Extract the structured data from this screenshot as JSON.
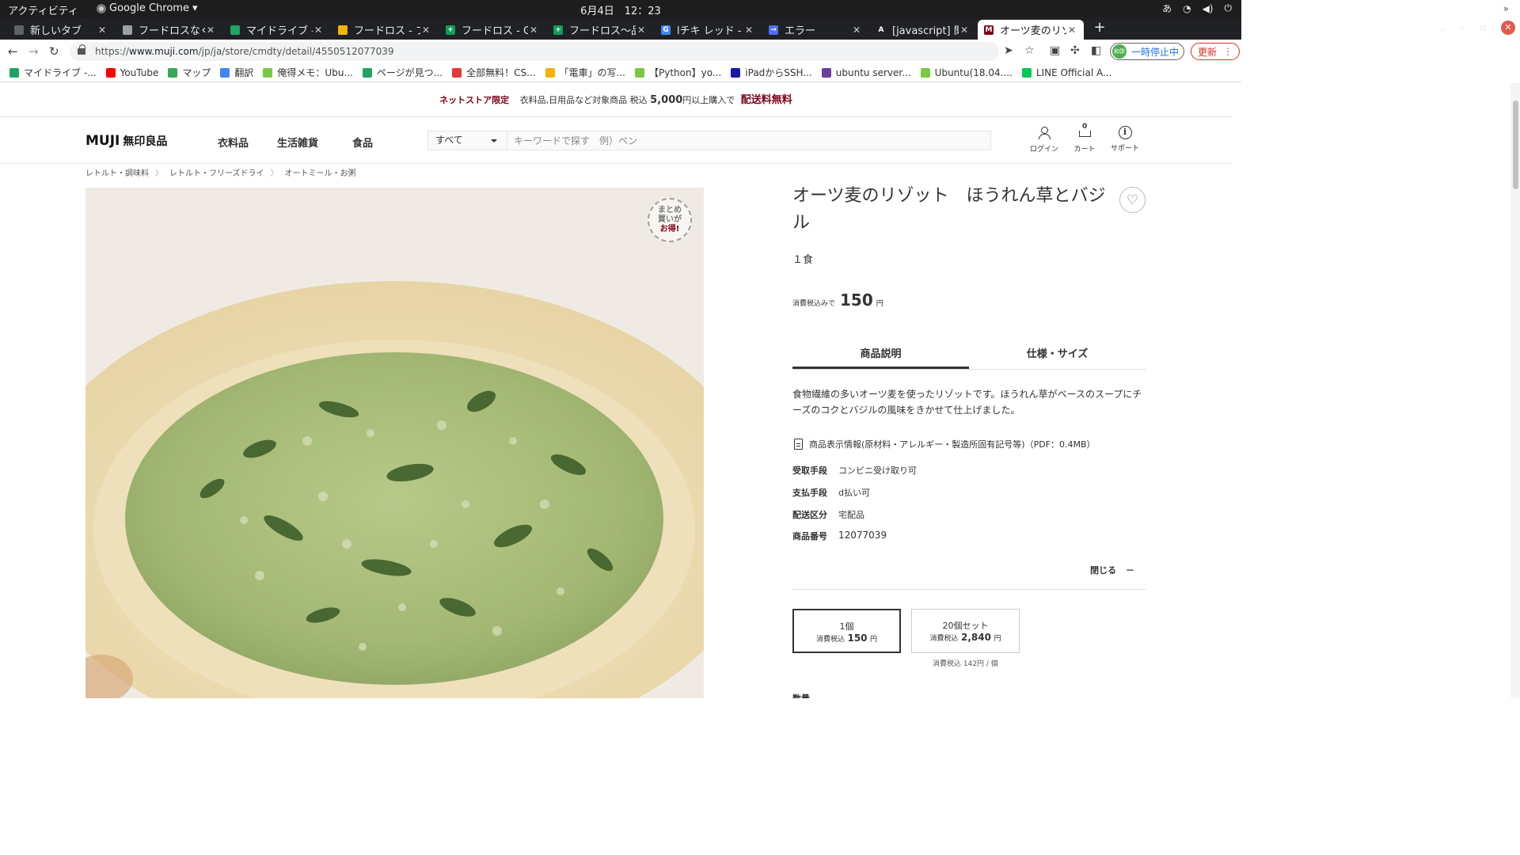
{
  "system": {
    "activities": "アクティビティ",
    "app_name": "Google Chrome",
    "clock": "6月4日　12：23",
    "ime": "あ"
  },
  "tabs": [
    {
      "title": "新しいタブ",
      "fav_color": "#5f6368",
      "fav_text": ""
    },
    {
      "title": "フードロスなく",
      "fav_color": "#9aa0a6",
      "fav_text": ""
    },
    {
      "title": "マイドライブ - G",
      "fav_color": "#1fa463",
      "fav_text": ""
    },
    {
      "title": "フードロス - ブ",
      "fav_color": "#f4b400",
      "fav_text": ""
    },
    {
      "title": "フードロス - Go",
      "fav_color": "#0f9d58",
      "fav_text": "+"
    },
    {
      "title": "フードロス〜品",
      "fav_color": "#0f9d58",
      "fav_text": "+"
    },
    {
      "title": "lチキ レッド - G",
      "fav_color": "#4285f4",
      "fav_text": "G"
    },
    {
      "title": "エラー",
      "fav_color": "#4b6ef5",
      "fav_text": "→"
    },
    {
      "title": "[javascript] 関連",
      "fav_color": "#222222",
      "fav_text": "A"
    },
    {
      "title": "オーツ麦のリゾ",
      "fav_color": "#7f0019",
      "fav_text": "M"
    }
  ],
  "address": {
    "scheme": "https://",
    "host": "www.muji.com",
    "path": "/jp/ja/store/cmdty/detail/4550512077039"
  },
  "profile": {
    "pause_label": "一時停止中",
    "avatar_label": "和弥",
    "update_label": "更新"
  },
  "bookmarks": [
    {
      "label": "マイドライブ -...",
      "color": "#1fa463"
    },
    {
      "label": "YouTube",
      "color": "#ff0000"
    },
    {
      "label": "マップ",
      "color": "#34a853"
    },
    {
      "label": "翻訳",
      "color": "#4285f4"
    },
    {
      "label": "俺得メモ：Ubu...",
      "color": "#7ac943"
    },
    {
      "label": "ページが見つ...",
      "color": "#1fa463"
    },
    {
      "label": "全部無料！CS...",
      "color": "#e53935"
    },
    {
      "label": "「電車」の写...",
      "color": "#f4b400"
    },
    {
      "label": "【Python】yo...",
      "color": "#7ac943"
    },
    {
      "label": "iPadからSSH...",
      "color": "#1a1aa6"
    },
    {
      "label": "ubuntu server...",
      "color": "#6b3fa0"
    },
    {
      "label": "Ubuntu(18.04....",
      "color": "#7ac943"
    },
    {
      "label": "LINE Official A...",
      "color": "#06c755"
    }
  ],
  "promo": {
    "tag": "ネットストア限定",
    "text_before": "衣料品,日用品など対象商品 税込",
    "amount": "5,000",
    "text_after": "円以上購入で",
    "highlight": "配送料無料"
  },
  "header": {
    "logo_main": "MUJI",
    "logo_sub": "無印良品",
    "nav": [
      "衣料品",
      "生活雑貨",
      "食品"
    ],
    "search_category": "すべて",
    "search_placeholder": "キーワードで探す　例）ペン",
    "login_label": "ログイン",
    "cart_label": "カート",
    "cart_count": "0",
    "support_label": "サポート"
  },
  "breadcrumb": [
    "レトルト・調味料",
    "レトルト・フリーズドライ",
    "オートミール・お粥"
  ],
  "badge": {
    "line1": "まとめ",
    "line2": "買いが",
    "line3": "お得!"
  },
  "product": {
    "title": "オーツ麦のリゾット　ほうれん草とバジル",
    "unit": "１食",
    "price_label": "消費税込みで",
    "price": "150",
    "price_unit": "円",
    "tabs": [
      "商品説明",
      "仕様・サイズ"
    ],
    "description": "食物繊維の多いオーツ麦を使ったリゾットです。ほうれん草がベースのスープにチーズのコクとバジルの風味をきかせて仕上げました。",
    "pdf_link": "商品表示情報(原材料・アレルギー・製造所固有記号等)（PDF：0.4MB）",
    "specs": [
      {
        "key": "受取手段",
        "value": "コンビニ受け取り可"
      },
      {
        "key": "支払手段",
        "value": "d払い可"
      },
      {
        "key": "配送区分",
        "value": "宅配品"
      },
      {
        "key": "商品番号",
        "value": "12077039"
      }
    ],
    "close_label": "閉じる",
    "close_symbol": "－",
    "options": [
      {
        "name": "1個",
        "tax_label": "消費税込",
        "price": "150",
        "unit": "円"
      },
      {
        "name": "20個セット",
        "tax_label": "消費税込",
        "price": "2,840",
        "unit": "円"
      }
    ],
    "per_unit_note": "消費税込 142円 / 個",
    "next_label": "数量"
  }
}
